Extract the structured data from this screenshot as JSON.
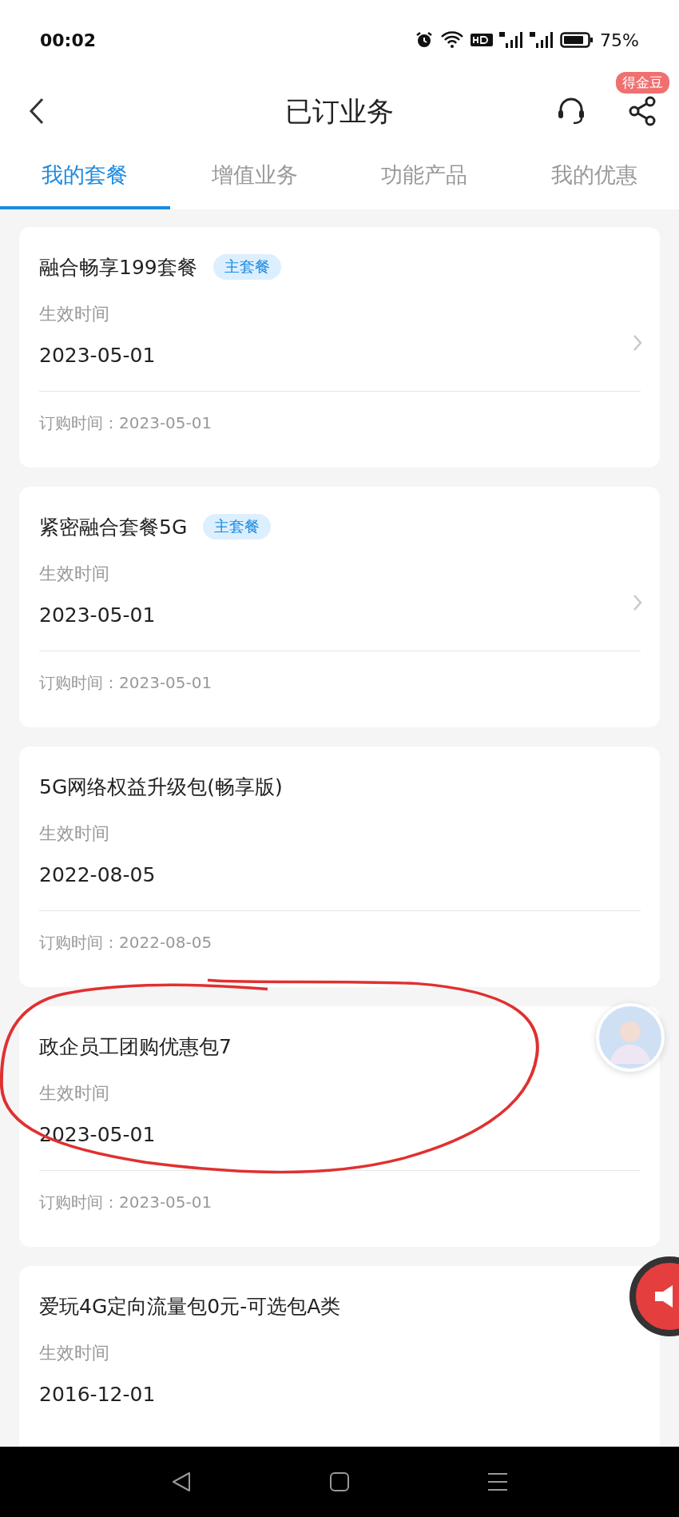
{
  "status_bar": {
    "time": "00:02",
    "battery": "75%"
  },
  "header": {
    "title": "已订业务",
    "badge": "得金豆"
  },
  "tabs": [
    {
      "label": "我的套餐",
      "selected": true
    },
    {
      "label": "增值业务",
      "selected": false
    },
    {
      "label": "功能产品",
      "selected": false
    },
    {
      "label": "我的优惠",
      "selected": false
    }
  ],
  "plans": [
    {
      "name": "融合畅享199套餐",
      "tag": "主套餐",
      "effective_label": "生效时间",
      "effective_date": "2023-05-01",
      "order_time": "订购时间：2023-05-01",
      "has_detail": true
    },
    {
      "name": "紧密融合套餐5G",
      "tag": "主套餐",
      "effective_label": "生效时间",
      "effective_date": "2023-05-01",
      "order_time": "订购时间：2023-05-01",
      "has_detail": true
    },
    {
      "name": "5G网络权益升级包(畅享版)",
      "effective_label": "生效时间",
      "effective_date": "2022-08-05",
      "order_time": "订购时间：2022-08-05",
      "has_detail": false
    },
    {
      "name": "政企员工团购优惠包7",
      "effective_label": "生效时间",
      "effective_date": "2023-05-01",
      "order_time": "订购时间：2023-05-01",
      "has_detail": false
    },
    {
      "name": "爱玩4G定向流量包0元-可选包A类",
      "effective_label": "生效时间",
      "effective_date": "2016-12-01",
      "has_detail": false
    }
  ]
}
